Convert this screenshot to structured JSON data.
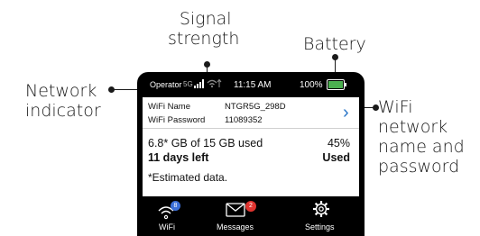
{
  "callouts": {
    "signal_strength": [
      "Signal",
      "strength"
    ],
    "battery": "Battery",
    "network_indicator": [
      "Network",
      "indicator"
    ],
    "wifi_name_password": [
      "WiFi",
      "network",
      "name and",
      "password"
    ]
  },
  "status_bar": {
    "operator": "Operator",
    "network": "5G",
    "time": "11:15 AM",
    "battery_percent": "100%",
    "battery_color": "#4caf50"
  },
  "wifi": {
    "name_label": "WiFi Name",
    "name_value": "NTGR5G_298D",
    "password_label": "WiFi Password",
    "password_value": "11089352"
  },
  "usage": {
    "summary": "6.8* GB of 15 GB used",
    "percent": "45%",
    "days_left": "11 days left",
    "used_label": "Used",
    "note": "*Estimated data."
  },
  "nav": {
    "wifi": {
      "label": "WiFi",
      "badge": "8",
      "badge_color": "#3b6fd8"
    },
    "messages": {
      "label": "Messages",
      "badge": "2",
      "badge_color": "#e0342f"
    },
    "settings": {
      "label": "Settings"
    }
  }
}
